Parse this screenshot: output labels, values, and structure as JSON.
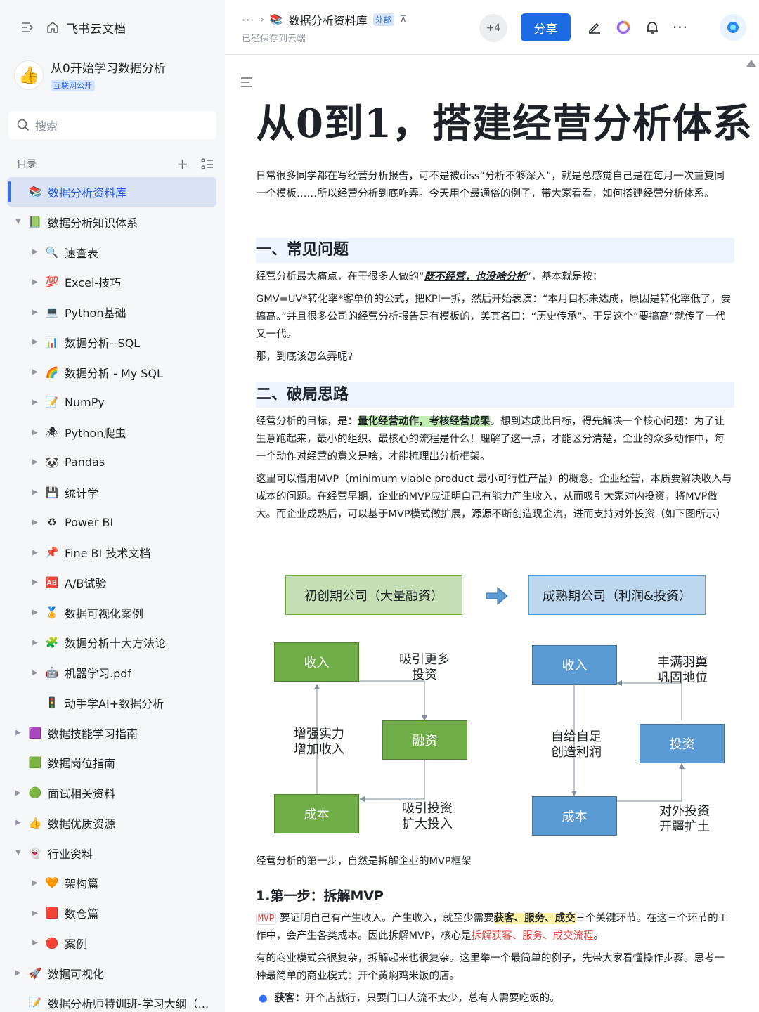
{
  "sidebar": {
    "app_name": "飞书云文档",
    "space_name": "从0开始学习数据分析",
    "space_tag": "互联网公开",
    "search_placeholder": "搜索",
    "toc_label": "目录",
    "items": [
      {
        "label": "数据分析资料库",
        "icon": "📚",
        "level": 0,
        "expand": "none",
        "active": true
      },
      {
        "label": "数据分析知识体系",
        "icon": "📗",
        "level": 0,
        "expand": "open"
      },
      {
        "label": "速查表",
        "icon": "🔍",
        "level": 1,
        "expand": "closed"
      },
      {
        "label": "Excel-技巧",
        "icon": "💯",
        "level": 1,
        "expand": "closed"
      },
      {
        "label": "Python基础",
        "icon": "💻",
        "level": 1,
        "expand": "closed"
      },
      {
        "label": "数据分析--SQL",
        "icon": "📊",
        "level": 1,
        "expand": "closed"
      },
      {
        "label": "数据分析 - My SQL",
        "icon": "🌈",
        "level": 1,
        "expand": "closed"
      },
      {
        "label": "NumPy",
        "icon": "📝",
        "level": 1,
        "expand": "closed"
      },
      {
        "label": "Python爬虫",
        "icon": "🕷",
        "level": 1,
        "expand": "closed"
      },
      {
        "label": "Pandas",
        "icon": "🐼",
        "level": 1,
        "expand": "closed"
      },
      {
        "label": "统计学",
        "icon": "💾",
        "level": 1,
        "expand": "closed"
      },
      {
        "label": "Power BI",
        "icon": "♻",
        "level": 1,
        "expand": "closed"
      },
      {
        "label": "Fine BI 技术文档",
        "icon": "📌",
        "level": 1,
        "expand": "closed"
      },
      {
        "label": "A/B试验",
        "icon": "🆎",
        "level": 1,
        "expand": "closed"
      },
      {
        "label": "数据可视化案例",
        "icon": "🏅",
        "level": 1,
        "expand": "closed"
      },
      {
        "label": "数据分析十大方法论",
        "icon": "🧩",
        "level": 1,
        "expand": "closed"
      },
      {
        "label": "机器学习.pdf",
        "icon": "🤖",
        "level": 1,
        "expand": "closed"
      },
      {
        "label": "动手学AI+数据分析",
        "icon": "🚦",
        "level": 1,
        "expand": "none"
      },
      {
        "label": "数据技能学习指南",
        "icon": "🟪",
        "level": 0,
        "expand": "closed"
      },
      {
        "label": "数据岗位指南",
        "icon": "🟩",
        "level": 0,
        "expand": "none"
      },
      {
        "label": "面试相关资料",
        "icon": "🟢",
        "level": 0,
        "expand": "closed"
      },
      {
        "label": "数据优质资源",
        "icon": "👍",
        "level": 0,
        "expand": "closed"
      },
      {
        "label": "行业资料",
        "icon": "👻",
        "level": 0,
        "expand": "open"
      },
      {
        "label": "架构篇",
        "icon": "🧡",
        "level": 1,
        "expand": "closed"
      },
      {
        "label": "数仓篇",
        "icon": "🟥",
        "level": 1,
        "expand": "closed"
      },
      {
        "label": "案例",
        "icon": "🔴",
        "level": 1,
        "expand": "closed"
      },
      {
        "label": "数据可视化",
        "icon": "🚀",
        "level": 0,
        "expand": "closed"
      },
      {
        "label": "数据分析师特训班-学习大纲（...",
        "icon": "📝",
        "level": 0,
        "expand": "none"
      }
    ]
  },
  "header": {
    "breadcrumb_more": "···",
    "breadcrumb_sep": "›",
    "doc_name": "数据分析资料库",
    "external_tag": "外部",
    "saved_status": "已经保存到云端",
    "collaborators": "+4",
    "share_label": "分享"
  },
  "doc": {
    "title": "从0到1，搭建经营分析体系",
    "intro": "日常很多同学都在写经营分析报告，可不是被diss“分析不够深入”，就是总感觉自己是在每月一次重复同一个模板……所以经营分析到底咋弄。今天用个最通俗的例子，带大家看看，如何搭建经营分析体系。",
    "h2_1": "一、常见问题",
    "p1_a": "经营分析最大痛点，在于很多人做的“",
    "p1_em": "既不经营，也没啥分析",
    "p1_b": "”，基本就是按：",
    "p2": "GMV=UV*转化率*客单价的公式，把KPI一拆，然后开始表演：“本月目标未达成，原因是转化率低了，要搞高。”并且很多公司的经营分析报告是有模板的，美其名曰：“历史传承”。于是这个“要搞高”就传了一代又一代。",
    "p3": "那，到底该怎么弄呢?",
    "h2_2": "二、破局思路",
    "p4_a": "经营分析的目标，是：",
    "p4_hl": "量化经营动作，考核经营成果",
    "p4_b": "。想到达成此目标，得先解决一个核心问题：为了让生意跑起来，最小的组织、最核心的流程是什么！理解了这一点，才能区分清楚，企业的众多动作中，每一个动作对经营的意义是啥，才能梳理出分析框架。",
    "p5": "这里可以借用MVP（minimum viable product 最小可行性产品）的概念。企业经营，本质要解决收入与成本的问题。在经营早期，企业的MVP应证明自己有能力产生收入，从而吸引大家对内投资，将MVP做大。而企业成熟后，可以基于MVP模式做扩展，源源不断创造现金流，进而支持对外投资（如下图所示）",
    "diagram": {
      "left_title": "初创期公司（大量融资）",
      "right_title": "成熟期公司（利润&投资）",
      "l_income": "收入",
      "l_finance": "融资",
      "l_cost": "成本",
      "l_label_top": [
        "吸引更多",
        "投资"
      ],
      "l_label_mid": [
        "增强实力",
        "增加收入"
      ],
      "l_label_bot": [
        "吸引投资",
        "扩大投入"
      ],
      "r_income": "收入",
      "r_invest": "投资",
      "r_cost": "成本",
      "r_label_top": [
        "丰满羽翼",
        "巩固地位"
      ],
      "r_label_mid": [
        "自给自足",
        "创造利润"
      ],
      "r_label_bot": [
        "对外投资",
        "开疆扩土"
      ]
    },
    "caption": "经营分析的第一步，自然是拆解企业的MVP框架",
    "h3_1": "1.第一步：拆解MVP",
    "p6_code": "MVP",
    "p6_a": " 要证明自己有产生收入。产生收入，就至少需要",
    "p6_hl": "获客、服务、成交",
    "p6_b": "三个关键环节。在这三个环节的工作中，会产生各类成本。因此拆解MVP，核心是",
    "p6_red": "拆解获客、服务、成交流程",
    "p6_c": "。",
    "p7": "有的商业模式会很复杂，拆解起来也很复杂。这里举一个最简单的例子，先带大家看懂操作步骤。思考一种最简单的商业模式：开个黄焖鸡米饭的店。",
    "bullet1_label": "获客：",
    "bullet1_text": "开个店就行，只要门口人流不太少，总有人需要吃饭的。"
  },
  "colors": {
    "accent": "#1c6ae4",
    "green_box": "#70ad47",
    "blue_box": "#5b9bd5",
    "heading_bg": "#eef3fd"
  }
}
